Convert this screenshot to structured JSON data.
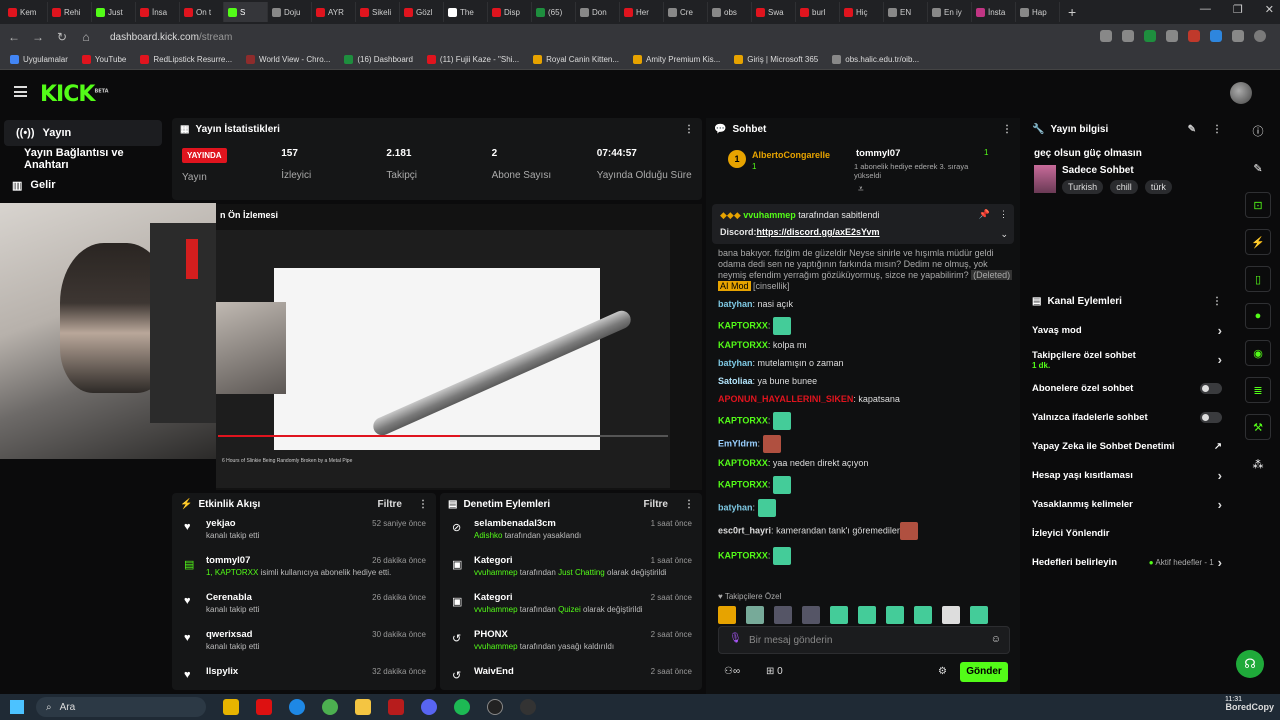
{
  "browser": {
    "tabs": [
      "Kem",
      "Rehi",
      "Just",
      "İnsa",
      "On t",
      "S",
      "Doju",
      "AYR",
      "Sikeli",
      "Gözl",
      "The",
      "Disp",
      "(65)",
      "Don",
      "Her",
      "Cre",
      "obs",
      "Swa",
      "burl",
      "Hiç",
      "EN",
      "En iy",
      "İnsta",
      "Hap"
    ],
    "url_host": "dashboard.kick.com",
    "url_path": "/stream",
    "bookmarks": [
      "Uygulamalar",
      "YouTube",
      "RedLipstick Resurre...",
      "World View - Chro...",
      "(16) Dashboard",
      "(11) Fujii Kaze - \"Shi...",
      "Royal Canin Kitten...",
      "Amity Premium Kis...",
      "Giriş | Microsoft 365",
      "obs.halic.edu.tr/oib..."
    ]
  },
  "brand": {
    "logo": "KICK",
    "beta": "BETA"
  },
  "leftnav": {
    "stream": "Yayın",
    "stream_key": "Yayın Bağlantısı ve Anahtarı",
    "income": "Gelir"
  },
  "stats": {
    "title": "Yayın İstatistikleri",
    "live_badge": "YAYINDA",
    "live_label": "Yayın",
    "viewers": "157",
    "viewers_label": "İzleyici",
    "followers": "2.181",
    "followers_label": "Takipçi",
    "subs": "2",
    "subs_label": "Abone Sayısı",
    "uptime": "07:44:57",
    "uptime_label": "Yayında Olduğu Süre"
  },
  "preview": {
    "title": "n Ön İzlemesi",
    "caption": "6 Hours of Slinkie Being Randomly Broken by a Metal Pipe"
  },
  "activity": {
    "title": "Etkinlik Akışı",
    "filter": "Filtre",
    "items": [
      {
        "name": "yekjao",
        "desc": "kanalı takip etti",
        "time": "52 saniye önce",
        "icon": "heart-icon"
      },
      {
        "name": "tommyl07",
        "desc_green": "1, KAPTORXX",
        "desc": " isimli kullanıcıya abonelik hediye etti.",
        "time": "26 dakika önce",
        "icon": "gift-icon"
      },
      {
        "name": "Cerenabla",
        "desc": "kanalı takip etti",
        "time": "26 dakika önce",
        "icon": "heart-icon"
      },
      {
        "name": "qwerixsad",
        "desc": "kanalı takip etti",
        "time": "30 dakika önce",
        "icon": "heart-icon"
      },
      {
        "name": "Ilspylix",
        "desc": "",
        "time": "32 dakika önce",
        "icon": "heart-icon"
      }
    ]
  },
  "modlog": {
    "title": "Denetim Eylemleri",
    "filter": "Filtre",
    "items": [
      {
        "name": "selambenadal3cm",
        "green": "Adishko",
        "desc": " tarafından yasaklandı",
        "time": "1 saat önce"
      },
      {
        "name": "Kategori",
        "green": "vvuhammep",
        "desc": " tarafından ",
        "green2": "Just Chatting",
        "desc2": " olarak değiştirildi",
        "time": "1 saat önce"
      },
      {
        "name": "Kategori",
        "green": "vvuhammep",
        "desc": " tarafından ",
        "green2": "Quizei",
        "desc2": " olarak değiştirildi",
        "time": "2 saat önce"
      },
      {
        "name": "PHONX",
        "green": "vvuhammep",
        "desc": " tarafından yasağı kaldırıldı",
        "time": "2 saat önce"
      },
      {
        "name": "WaivEnd",
        "green": "",
        "desc": "",
        "time": "2 saat önce"
      }
    ]
  },
  "chat": {
    "title": "Sohbet",
    "top_gifter": "AlbertoCongarelle",
    "top_gifter_count": "1",
    "gift_user": "tommyl07",
    "gift_count": "1",
    "gift_text": "1 abonelik hediye ederek 3. sıraya yükseldi",
    "pinned_by": "vvuhammep",
    "pinned_suffix": " tarafından sabitlendi",
    "pinned_label": "Discord:",
    "pinned_link": "https://discord.gg/axE2sYvm",
    "long_msg": "bana bakıyor. fiziğim de güzeldir Neyse sinirle ve hışımla müdür geldi odama dedi sen ne yaptığının farkında mısın? Dedim ne olmuş, yok neymiş efendim yerrağım gözüküyormuş, sizce ne yapabilirim?",
    "deleted_tag": "(Deleted)",
    "ai_tag": "AI Mod",
    "cat_tag": "[cinsellik]",
    "messages": [
      {
        "user": "batyhan",
        "text": "nasi açık",
        "color": "#7ec8e3"
      },
      {
        "user": "KAPTORXX",
        "text": "",
        "color": "#53fc18",
        "emote": true
      },
      {
        "user": "KAPTORXX",
        "text": "kolpa mı",
        "color": "#53fc18"
      },
      {
        "user": "batyhan",
        "text": "mutelamışın o zaman",
        "color": "#7ec8e3"
      },
      {
        "user": "Satoliaa",
        "text": "ya bune bunee",
        "color": "#b3e5fc"
      },
      {
        "user": "APONUN_HAYALLERINI_SIKEN",
        "text": "kapatsana",
        "color": "#e0141e"
      },
      {
        "user": "KAPTORXX",
        "text": "",
        "color": "#53fc18",
        "emote": true
      },
      {
        "user": "EmYldrm",
        "text": "",
        "color": "#9ad0ff",
        "emote": true
      },
      {
        "user": "KAPTORXX",
        "text": "yaa neden direkt açıyon",
        "color": "#53fc18"
      },
      {
        "user": "KAPTORXX",
        "text": "",
        "color": "#53fc18",
        "emote": true
      },
      {
        "user": "batyhan",
        "text": "",
        "color": "#7ec8e3",
        "emote": true
      },
      {
        "user": "esc0rt_hayri",
        "text": "kamerandan tank'ı göremediler",
        "color": "#ddd"
      },
      {
        "user": "KAPTORXX",
        "text": "",
        "color": "#53fc18",
        "emote": true
      }
    ],
    "followers_only": "Takipçilere Özel",
    "input_placeholder": "Bir mesaj gönderin",
    "points": "0",
    "send": "Gönder"
  },
  "streaminfo": {
    "title": "Yayın bilgisi",
    "stream_title": "geç olsun güç olmasın",
    "category": "Sadece Sohbet",
    "tags": [
      "Turkish",
      "chill",
      "türk"
    ]
  },
  "channel_actions": {
    "title": "Kanal Eylemleri",
    "slow_mode": "Yavaş mod",
    "followers_chat": "Takipçilere özel sohbet",
    "followers_chat_sub": "1 dk.",
    "subs_chat": "Abonelere özel sohbet",
    "emotes_chat": "Yalnızca ifadelerle sohbet",
    "ai_mod": "Yapay Zeka ile Sohbet Denetimi",
    "age_limits": "Hesap yaşı kısıtlaması",
    "banned_words": "Yasaklanmış kelimeler",
    "redirect": "İzleyici Yönlendir",
    "goals": "Hedefleri belirleyin",
    "goals_status": "Aktif hedefler - 1"
  },
  "taskbar": {
    "search": "Ara",
    "time": "11:31"
  },
  "watermark": "BoredCopy",
  "colors": {
    "accent": "#53fc18",
    "live": "#e0141e",
    "background": "#0b0b0c",
    "panel": "#151617"
  }
}
